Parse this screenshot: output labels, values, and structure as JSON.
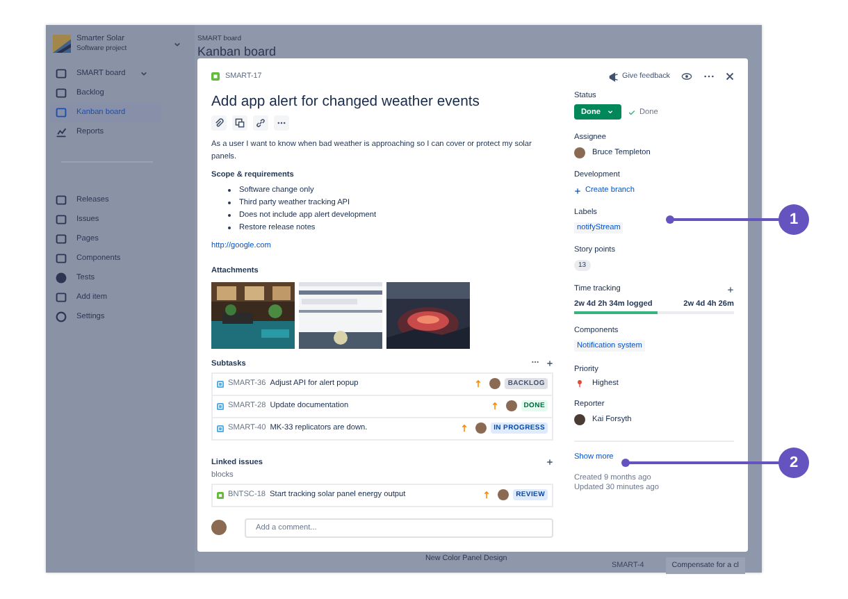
{
  "sidebar": {
    "project": {
      "name": "Smarter Solar",
      "type": "Software project"
    },
    "items": [
      {
        "label": "SMART board",
        "kind": "dropdown",
        "selected": false
      },
      {
        "label": "Backlog",
        "kind": "link",
        "selected": false
      },
      {
        "label": "Kanban board",
        "kind": "link",
        "selected": true
      },
      {
        "label": "Reports",
        "kind": "link",
        "selected": false
      },
      {
        "label": "Releases",
        "kind": "section",
        "selected": false
      },
      {
        "label": "Issues",
        "kind": "link",
        "selected": false
      },
      {
        "label": "Pages",
        "kind": "link",
        "selected": false
      },
      {
        "label": "Components",
        "kind": "link",
        "selected": false
      },
      {
        "label": "Tests",
        "kind": "link",
        "selected": false
      },
      {
        "label": "Add item",
        "kind": "link",
        "selected": false
      },
      {
        "label": "Settings",
        "kind": "link",
        "selected": false
      }
    ]
  },
  "board": {
    "breadcrumb": "SMART board",
    "title": "Kanban board",
    "cards": [
      {
        "title": "New Color Panel Design"
      },
      {
        "key": "SMART-4",
        "title": "Compensate for a cl"
      }
    ]
  },
  "issue": {
    "key": "SMART-17",
    "header_actions": {
      "feedback": "Give feedback"
    },
    "title": "Add app alert for changed weather events",
    "description": "As a user I want to know when bad weather is approaching so I can cover or protect my solar panels.",
    "scope_heading": "Scope & requirements",
    "bullets": [
      "Software change only",
      "Third party weather tracking API",
      "Does not include app alert development",
      "Restore release notes"
    ],
    "link": "http://google.com",
    "attachments_heading": "Attachments",
    "subtasks_heading": "Subtasks",
    "subtasks": [
      {
        "key": "SMART-36",
        "summary": "Adjust API for alert popup",
        "status": "BACKLOG",
        "kind": "todo"
      },
      {
        "key": "SMART-28",
        "summary": "Update documentation",
        "status": "DONE",
        "kind": "done"
      },
      {
        "key": "SMART-40",
        "summary": "MK-33 replicators are down.",
        "status": "IN PROGRESS",
        "kind": "progress"
      }
    ],
    "linked_heading": "Linked issues",
    "relation": "blocks",
    "linked": [
      {
        "key": "BNTSC-18",
        "summary": "Start tracking solar panel energy output",
        "status": "REVIEW",
        "kind": "progress"
      }
    ],
    "comment": {
      "placeholder": "Add a comment..."
    },
    "fields": {
      "status_label": "Status",
      "status": "Done",
      "resolution": "Done",
      "assignee_label": "Assignee",
      "assignee": "Bruce Templeton",
      "development_label": "Development",
      "create_branch": "Create branch",
      "labels_label": "Labels",
      "label": "notifyStream",
      "points_label": "Story points",
      "points": "13",
      "time_label": "Time tracking",
      "logged": "2w 4d 2h 34m logged",
      "remaining": "2w 4d 4h 26m",
      "level": 0.52,
      "components_label": "Components",
      "component": "Notification system",
      "priority_label": "Priority",
      "priority": "Highest",
      "reporter_label": "Reporter",
      "reporter": "Kai Forsyth",
      "show_more": "Show more",
      "created": "Created 9 months ago",
      "updated": "Updated 30 minutes ago"
    }
  },
  "callouts": [
    "1",
    "2"
  ]
}
